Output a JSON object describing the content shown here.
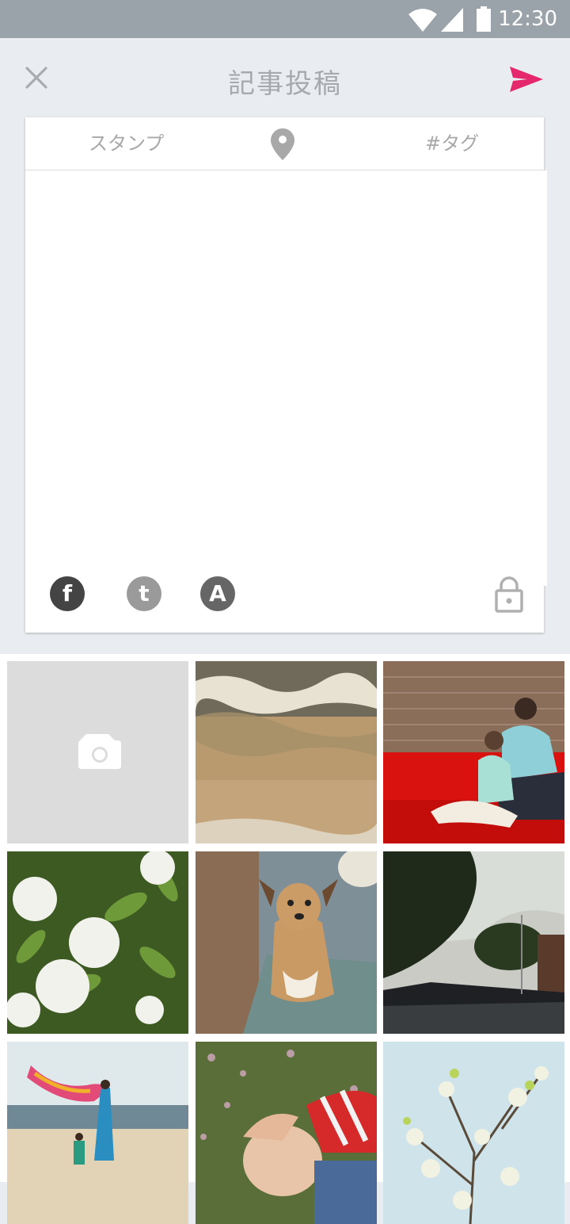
{
  "status_bar": {
    "time": "12:30"
  },
  "app_bar": {
    "title": "記事投稿",
    "close_icon": "close-icon",
    "send_icon": "send-icon"
  },
  "composer": {
    "toolbar": {
      "stamp_label": "スタンプ",
      "location_icon": "location-pin-icon",
      "tag_label": "#タグ"
    },
    "body_text": "",
    "share": [
      {
        "name": "facebook",
        "glyph": "f"
      },
      {
        "name": "twitter",
        "glyph": "t"
      },
      {
        "name": "ameba",
        "glyph": "A"
      }
    ],
    "privacy_icon": "lock-icon"
  },
  "gallery": {
    "camera_tile_icon": "camera-icon",
    "photos": [
      "beach-waves",
      "mother-daughter-sofa",
      "white-flowers",
      "dog",
      "evening-street",
      "beach-scarf",
      "child-lying-grass",
      "blossom-branch"
    ]
  },
  "colors": {
    "accent": "#e5286b",
    "status_bar": "#9aa3aa",
    "background": "#e9ecf0"
  }
}
